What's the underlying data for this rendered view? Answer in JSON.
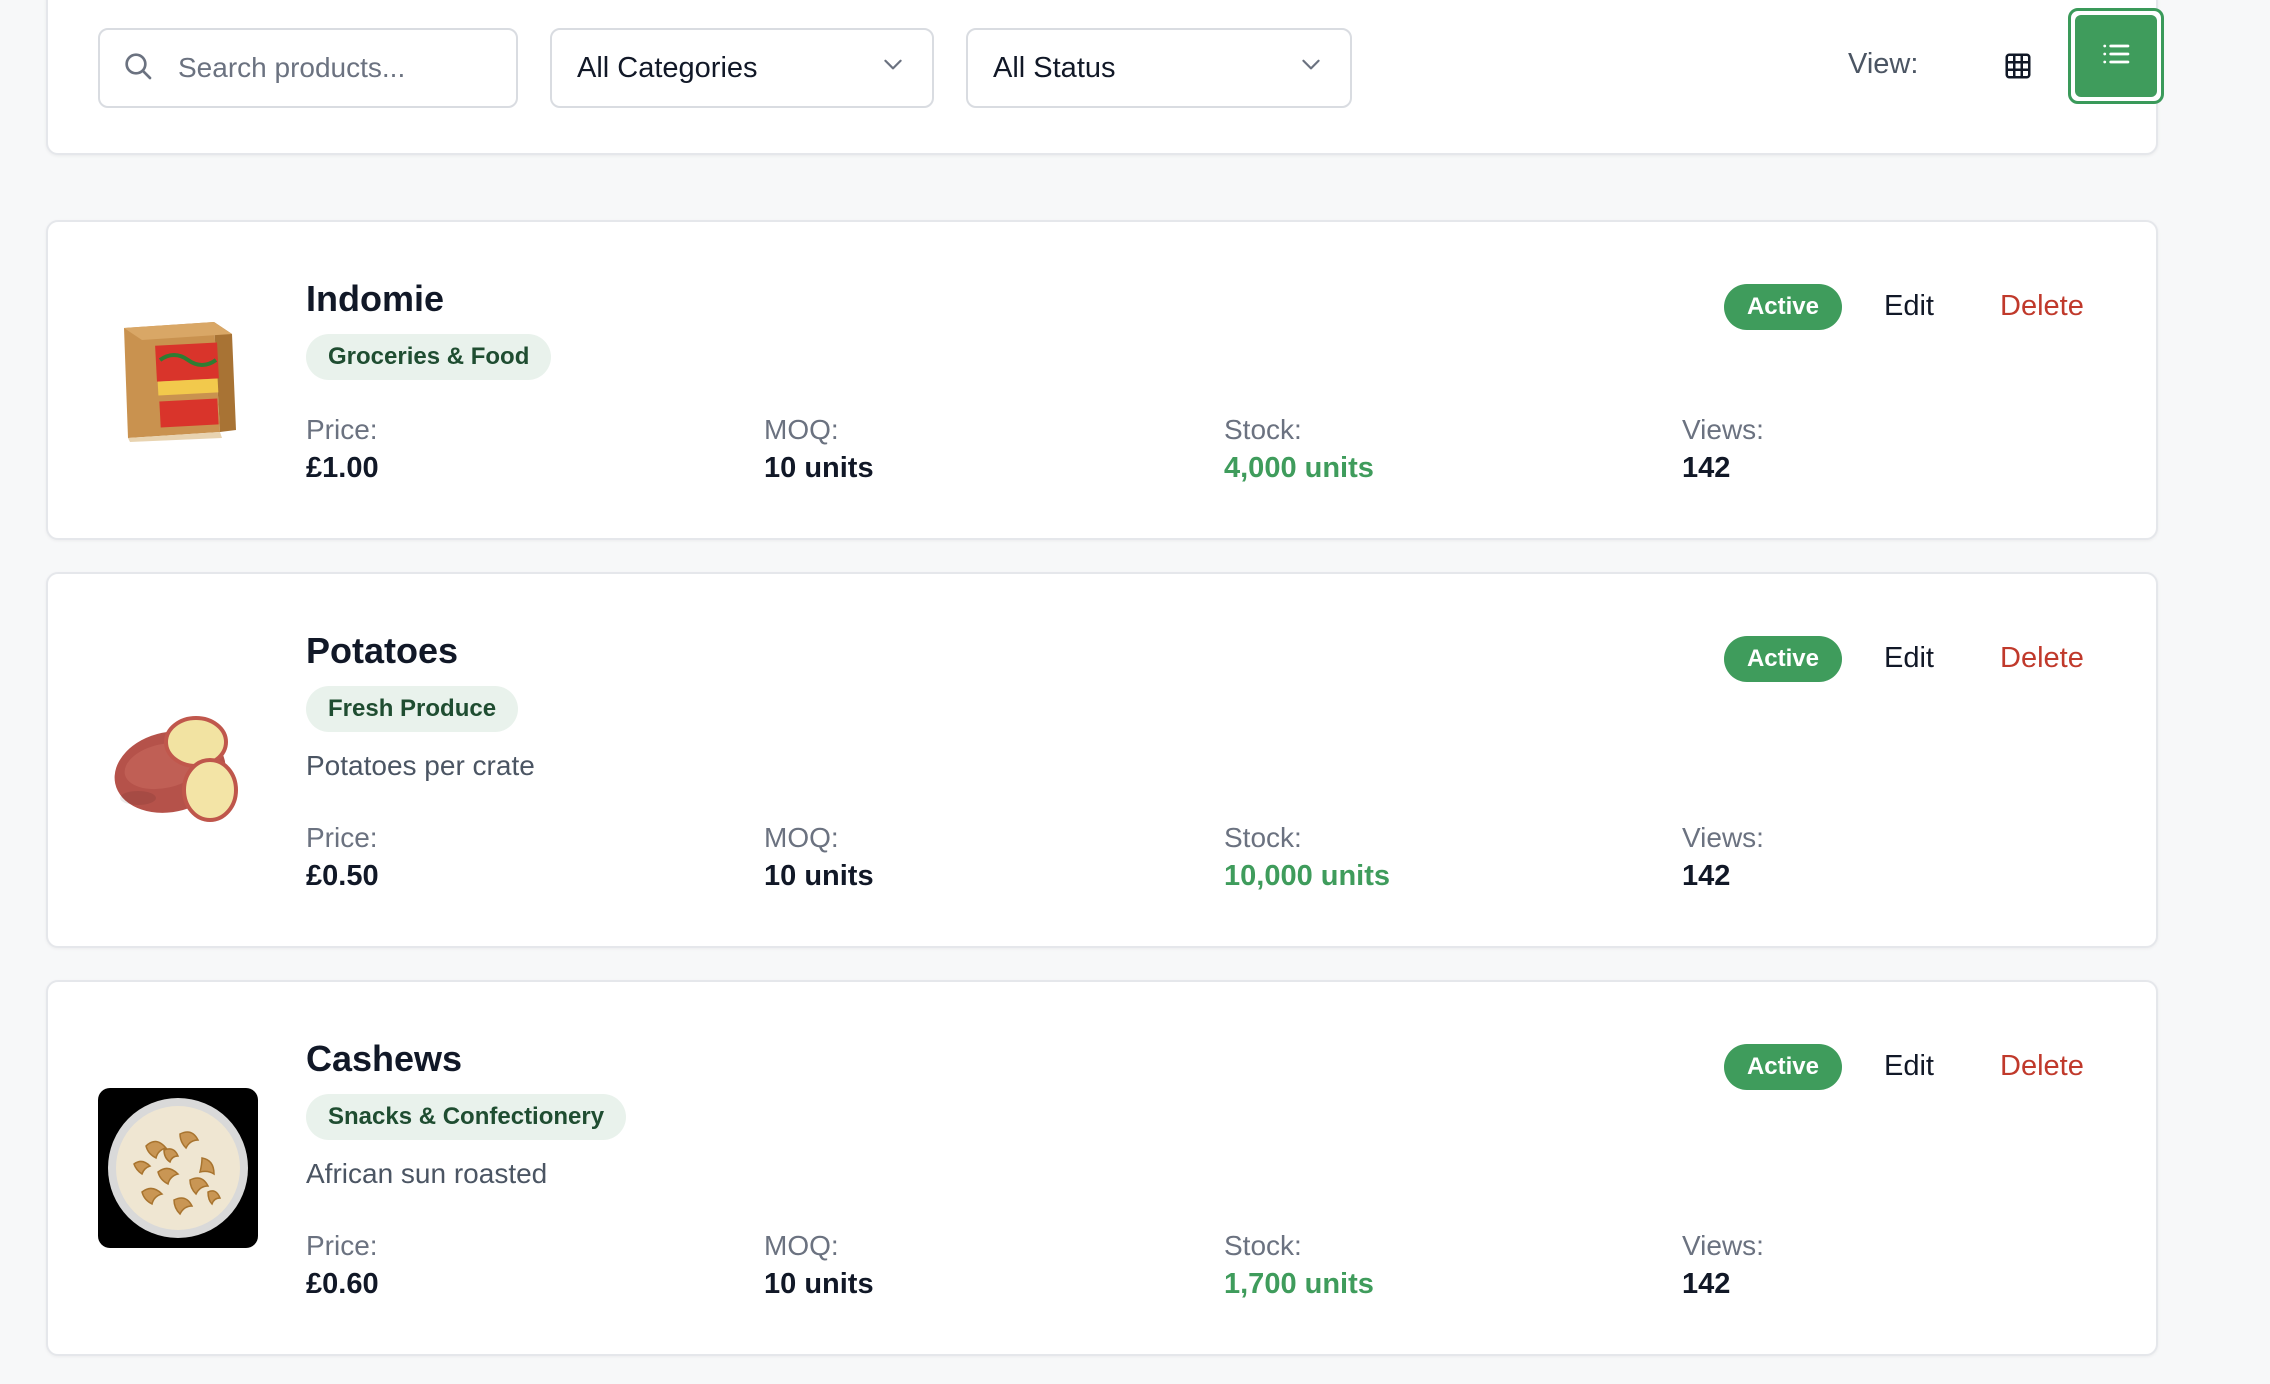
{
  "filters": {
    "search_placeholder": "Search products...",
    "category_selected": "All Categories",
    "status_selected": "All Status",
    "view_label": "View:",
    "active_view": "list",
    "accent_color": "#3f9c5c"
  },
  "labels": {
    "price": "Price:",
    "moq": "MOQ:",
    "stock": "Stock:",
    "views": "Views:",
    "edit": "Edit",
    "delete": "Delete"
  },
  "products": [
    {
      "name": "Indomie",
      "category": "Groceries & Food",
      "description": "",
      "price": "£1.00",
      "moq": "10 units",
      "stock": "4,000 units",
      "views": "142",
      "status": "Active",
      "image": "noodle-box"
    },
    {
      "name": "Potatoes",
      "category": "Fresh Produce",
      "description": "Potatoes per crate",
      "price": "£0.50",
      "moq": "10 units",
      "stock": "10,000 units",
      "views": "142",
      "status": "Active",
      "image": "potatoes"
    },
    {
      "name": "Cashews",
      "category": "Snacks & Confectionery",
      "description": "African sun roasted",
      "price": "£0.60",
      "moq": "10 units",
      "stock": "1,700 units",
      "views": "142",
      "status": "Active",
      "image": "cashew-bowl"
    }
  ]
}
